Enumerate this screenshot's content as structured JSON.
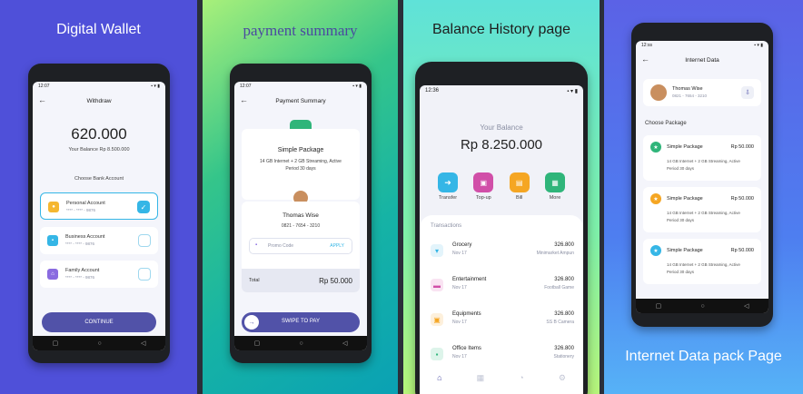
{
  "panels": {
    "p1": {
      "title": "Digital Wallet",
      "status_time": "12:07",
      "header": "Withdraw",
      "amount": "620.000",
      "balance_line": "Your Balance Rp 8.500.000",
      "choose_label": "Choose Bank Account",
      "accounts": [
        {
          "name": "Personal Account",
          "number": "**** - **** - 9876",
          "color": "#f5b731"
        },
        {
          "name": "Business Account",
          "number": "**** - **** - 9876",
          "color": "#35b6e6"
        },
        {
          "name": "Family Account",
          "number": "**** - **** - 9876",
          "color": "#8a6be0"
        }
      ],
      "continue_label": "CONTINUE"
    },
    "p2": {
      "title": "payment summary",
      "status_time": "12:07",
      "header": "Payment Summary",
      "package_name": "Simple Package",
      "package_desc": "14 GB Internet + 2 GB Streaming, Active Period 30 days",
      "user_name": "Thomas Wise",
      "user_phone": "0821 - 7654 - 3210",
      "promo_placeholder": "Promo Code",
      "apply_label": "APPLY",
      "total_label": "Total",
      "total_value": "Rp 50.000",
      "swipe_label": "SWIPE TO PAY"
    },
    "p3": {
      "title": "Balance History page",
      "status_time": "12:36",
      "balance_label": "Your Balance",
      "balance_value": "Rp 8.250.000",
      "actions": [
        {
          "label": "Transfer",
          "color": "#35b6e6"
        },
        {
          "label": "Top-up",
          "color": "#d14fa8"
        },
        {
          "label": "Bill",
          "color": "#f5a623"
        },
        {
          "label": "More",
          "color": "#2fb57a"
        }
      ],
      "transactions_label": "Transactions",
      "transactions": [
        {
          "title": "Grocery",
          "date": "Nov 17",
          "amount": "326.800",
          "merchant": "Minimarket Ampun",
          "color": "#35b6e6"
        },
        {
          "title": "Entertainment",
          "date": "Nov 17",
          "amount": "326.800",
          "merchant": "Football Game",
          "color": "#d14fa8"
        },
        {
          "title": "Equipments",
          "date": "Nov 17",
          "amount": "326.800",
          "merchant": "SS B Camera",
          "color": "#f5a623"
        },
        {
          "title": "Office Items",
          "date": "Nov 17",
          "amount": "326.800",
          "merchant": "Stationery",
          "color": "#2fb57a"
        }
      ]
    },
    "p4": {
      "title": "Internet Data pack Page",
      "status_time": "12:ss",
      "header": "Internet Data",
      "user_name": "Thomas Wise",
      "user_phone": "0821 - 7654 - 3210",
      "choose_label": "Choose Package",
      "packages": [
        {
          "name": "Simple Package",
          "price": "Rp 50.000",
          "desc1": "14 GB Internet + 2 GB Streaming, Active",
          "desc2": "Period 30 days",
          "color": "#2fb57a"
        },
        {
          "name": "Simple Package",
          "price": "Rp 50.000",
          "desc1": "14 GB Internet + 2 GB Streaming, Active",
          "desc2": "Period 30 days",
          "color": "#f5a623"
        },
        {
          "name": "Simple Package",
          "price": "Rp 50.000",
          "desc1": "14 GB Internet + 2 GB Streaming, Active",
          "desc2": "Period 30 days",
          "color": "#35b6e6"
        }
      ]
    }
  }
}
